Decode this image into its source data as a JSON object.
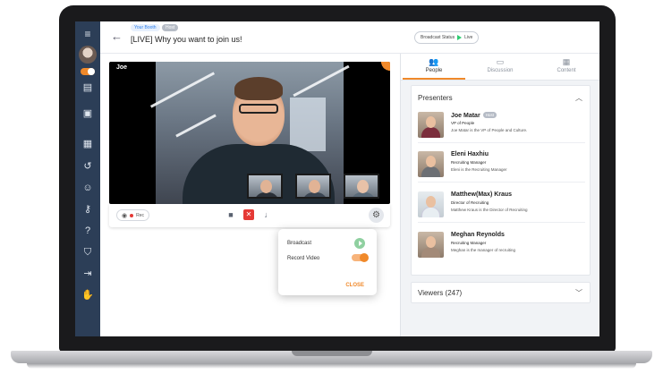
{
  "header": {
    "badge_booth": "Your Booth",
    "badge_host": "Host",
    "title": "[LIVE] Why you want to join us!",
    "broadcast_status_label": "Broadcast Status",
    "broadcast_status_value": "Live"
  },
  "video": {
    "speaker_name": "Joe",
    "rec_label": "Rec"
  },
  "settings_popover": {
    "broadcast_label": "Broadcast",
    "record_video_label": "Record Video",
    "record_video_on": true,
    "close_label": "CLOSE"
  },
  "tabs": [
    {
      "label": "People",
      "icon": "people-icon",
      "active": true
    },
    {
      "label": "Discussion",
      "icon": "discussion-icon",
      "active": false
    },
    {
      "label": "Content",
      "icon": "content-icon",
      "active": false
    }
  ],
  "presenters": {
    "title": "Presenters",
    "items": [
      {
        "name": "Joe Matar",
        "host_badge": "Host",
        "role": "VP of People",
        "description": "Joe Matar is the VP of People and Culture."
      },
      {
        "name": "Eleni Haxhiu",
        "host_badge": "",
        "role": "Recruiting Manager",
        "description": "Eleni is the Recruiting Manager"
      },
      {
        "name": "Matthew(Max) Kraus",
        "host_badge": "",
        "role": "Director of Recruiting",
        "description": "Matthew Kraus is the Director of Recruiting"
      },
      {
        "name": "Meghan Reynolds",
        "host_badge": "",
        "role": "Recruiting Manager",
        "description": "Meghan is the manager of recruiting"
      }
    ]
  },
  "viewers": {
    "label": "Viewers (247)"
  },
  "colors": {
    "accent": "#f0892a",
    "sidebar": "#2c3e57",
    "live_green": "#2ecc71"
  }
}
